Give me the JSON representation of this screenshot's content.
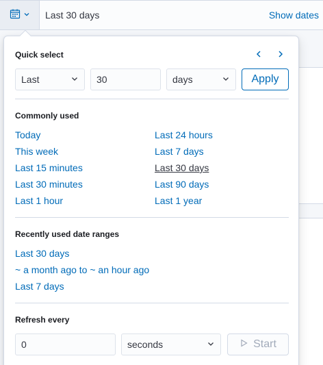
{
  "date_bar": {
    "range_label": "Last 30 days",
    "show_dates_label": "Show dates",
    "calendar_icon": "calendar-icon",
    "chevron_icon": "chevron-down-icon"
  },
  "quick_select": {
    "title": "Quick select",
    "tense_value": "Last",
    "amount_value": "30",
    "unit_value": "days",
    "apply_label": "Apply",
    "prev_icon": "chevron-left-icon",
    "next_icon": "chevron-right-icon"
  },
  "commonly_used": {
    "title": "Commonly used",
    "left": [
      "Today",
      "This week",
      "Last 15 minutes",
      "Last 30 minutes",
      "Last 1 hour"
    ],
    "right": [
      "Last 24 hours",
      "Last 7 days",
      "Last 30 days",
      "Last 90 days",
      "Last 1 year"
    ],
    "active": "Last 30 days"
  },
  "recently_used": {
    "title": "Recently used date ranges",
    "items": [
      "Last 30 days",
      "~ a month ago to ~ an hour ago",
      "Last 7 days"
    ]
  },
  "refresh": {
    "title": "Refresh every",
    "interval_value": "0",
    "unit_value": "seconds",
    "start_label": "Start",
    "play_icon": "play-icon"
  },
  "colors": {
    "link": "#006bb8",
    "border": "#d3dae6",
    "text": "#343741"
  }
}
